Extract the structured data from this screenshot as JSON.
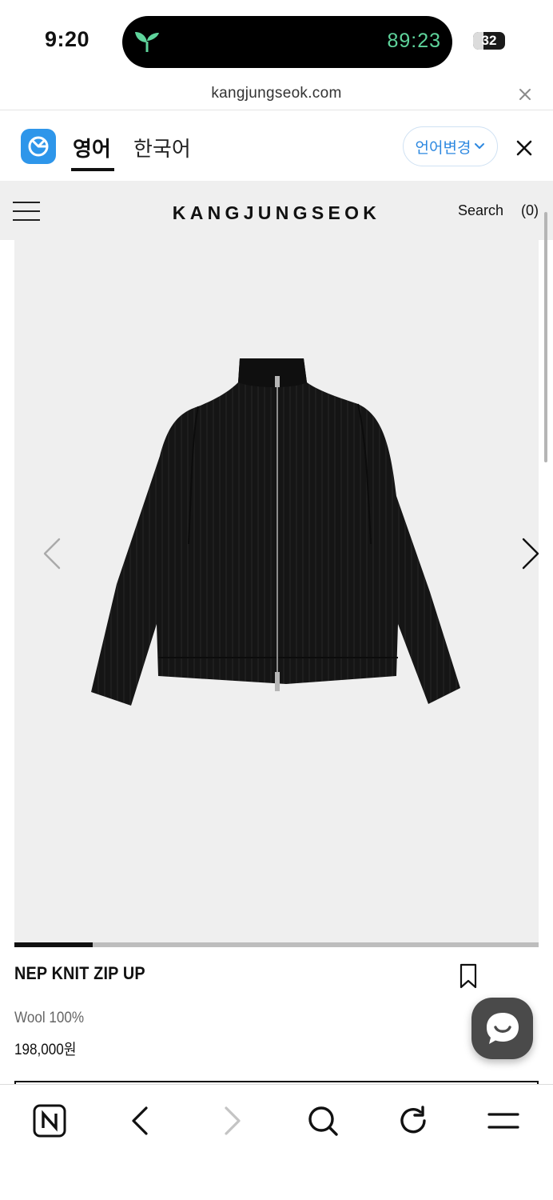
{
  "status_bar": {
    "time": "9:20",
    "timer": "89:23",
    "timer_color": "#5ed39b",
    "battery": "32"
  },
  "browser": {
    "url": "kangjungseok.com"
  },
  "translate_bar": {
    "tabs": [
      {
        "label": "영어",
        "active": true
      },
      {
        "label": "한국어",
        "active": false
      }
    ],
    "change_language_label": "언어변경",
    "accent_color": "#2d88e0"
  },
  "site_header": {
    "brand": "KANGJUNGSEOK",
    "search_label": "Search",
    "cart_count": "(0)"
  },
  "gallery": {
    "progress": 0.15
  },
  "product": {
    "name": "NEP KNIT ZIP UP",
    "material": "Wool 100%",
    "price": "198,000원"
  },
  "toolbar": {
    "icons": [
      "naver-n-icon",
      "back-arrow-icon",
      "forward-arrow-icon",
      "search-icon",
      "refresh-icon",
      "menu-icon"
    ]
  }
}
